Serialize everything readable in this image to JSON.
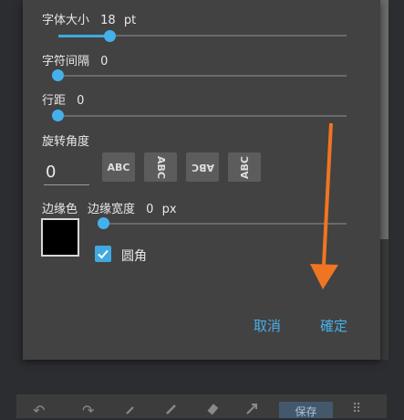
{
  "dialog": {
    "font_size": {
      "label": "字体大小",
      "value": "18",
      "unit": "pt",
      "level": 0.18
    },
    "letter_spacing": {
      "label": "字符间隔",
      "value": "0",
      "level": 0.0
    },
    "line_spacing": {
      "label": "行距",
      "value": "0",
      "level": 0.0
    },
    "rotation": {
      "label": "旋转角度",
      "value": "0",
      "options": [
        {
          "text": "ABC",
          "orientation": "horizontal"
        },
        {
          "text": "ABC",
          "orientation": "rotated-90"
        },
        {
          "text": "ABC",
          "orientation": "rotated-180"
        },
        {
          "text": "ABC",
          "orientation": "rotated-270"
        }
      ]
    },
    "border": {
      "color_label": "边缘色",
      "color": "#000000",
      "width_label": "边缘宽度",
      "width_value": "0",
      "width_unit": "px",
      "level": 0.0
    },
    "rounded_corner": {
      "label": "圆角",
      "checked": true
    },
    "cancel_label": "取消",
    "confirm_label": "確定"
  },
  "toolbar": {
    "icons": [
      "undo-icon",
      "redo-icon",
      "eyedropper-icon",
      "pencil-icon",
      "eraser-icon",
      "expand-icon",
      "grid-icon"
    ],
    "save_label": "保存"
  },
  "colors": {
    "accent": "#3fa9e0",
    "arrow": "#f07522",
    "dialog_bg": "#424242"
  }
}
